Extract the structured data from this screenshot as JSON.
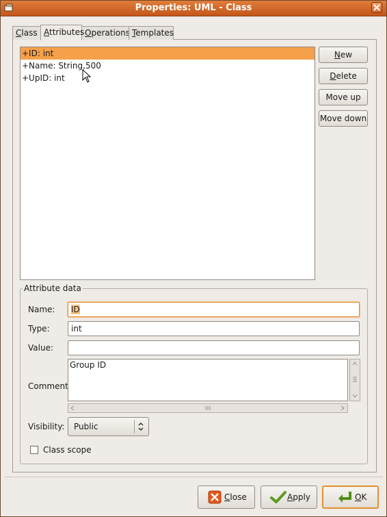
{
  "window": {
    "title": "Properties: UML - Class"
  },
  "tabs": [
    {
      "label": "Class",
      "accel": "C",
      "rest": "lass"
    },
    {
      "label": "Attributes",
      "accel": "A",
      "rest": "ttributes"
    },
    {
      "label": "Operations",
      "accel": "O",
      "rest": "perations"
    },
    {
      "label": "Templates",
      "accel": "T",
      "rest": "emplates"
    }
  ],
  "attributes": {
    "items": [
      "+ID: int",
      "+Name: String,500",
      "+UpID: int"
    ],
    "selected_index": 0
  },
  "side_buttons": {
    "new": {
      "accel": "N",
      "rest": "ew"
    },
    "delete": {
      "accel": "D",
      "rest": "elete"
    },
    "move_up": "Move up",
    "move_down": "Move down"
  },
  "attribute_data": {
    "title": "Attribute data",
    "name_label": "Name:",
    "name_value": "ID",
    "type_label": "Type:",
    "type_value": "int",
    "value_label": "Value:",
    "value_value": "",
    "comment_label": "Comment:",
    "comment_value": "Group ID",
    "visibility_label": "Visibility:",
    "visibility_value": "Public",
    "class_scope_label": "Class scope",
    "class_scope_checked": false
  },
  "dialog_buttons": {
    "close": {
      "accel": "C",
      "rest": "lose"
    },
    "apply": {
      "accel": "A",
      "rest": "pply"
    },
    "ok": {
      "accel": "O",
      "rest": "K"
    }
  },
  "colors": {
    "title_bar": "#d2652a",
    "selection": "#f5a04a",
    "focus": "#e0902c"
  }
}
